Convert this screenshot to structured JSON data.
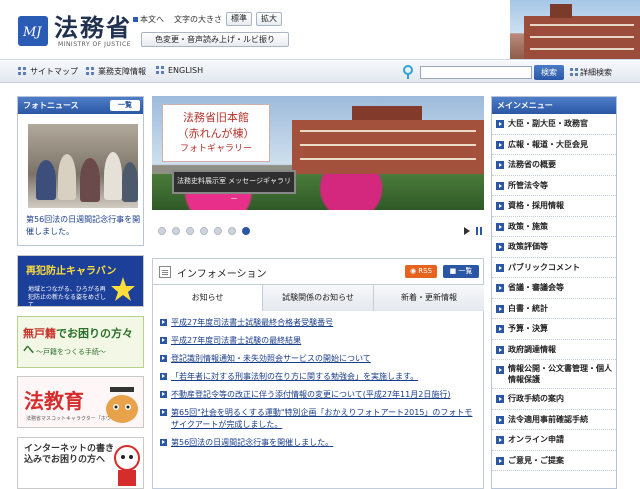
{
  "header": {
    "site_title": "法務省",
    "site_subtitle": "MINISTRY OF JUSTICE",
    "text_link": "本文へ",
    "font_size_label": "文字の大きさ",
    "size_normal": "標準",
    "size_large": "拡大",
    "accessibility": "色変更・音声読み上げ・ルビ振り"
  },
  "subnav": {
    "sitemap": "サイトマップ",
    "business": "業務支障情報",
    "english": "ENGLISH",
    "search_placeholder": "",
    "search_button": "検索",
    "advanced_search": "詳細検索"
  },
  "photo_news": {
    "title": "フォトニュース",
    "list_button": "一覧",
    "caption": "第56回法の日週間記念行事を開催しました。"
  },
  "banners": {
    "caravan_title": "再犯防止キャラバン",
    "caravan_text": "地域とつながる、ひろがる再犯防止の新たなる姿をめざして",
    "koseki_title_red": "無戸籍",
    "koseki_title_rest": "でお困りの方々へ",
    "koseki_subtitle": "～戸籍をつくる手続～",
    "hokyoiku_title": "法教育",
    "hokyoiku_subtitle": "法務省マスコットキャラクター「ホウリス君」",
    "internet_title": "インターネットの書き込みでお困りの方へ"
  },
  "slideshow": {
    "title_line1": "法務省旧本館",
    "title_line2": "（赤れんが棟）",
    "title_line3": "フォトギャラリー",
    "sign_text": "法務史料展示室 メッセージギャラリー",
    "dot_count": 7,
    "active_dot": 7
  },
  "info": {
    "title": "インフォメーション",
    "rss": "RSS",
    "list_button": "一覧",
    "tabs": [
      "お知らせ",
      "試験関係のお知らせ",
      "新着・更新情報"
    ],
    "items": [
      "平成27年度司法書士試験最終合格者受験番号",
      "平成27年度司法書士試験の最終結果",
      "登記識別情報通知・未失効照会サービスの開始について",
      "「若年者に対する刑事法制の在り方に関する勉強会」を実施します。",
      "不動産登記令等の改正に伴う添付情報の変更について(平成27年11月2日施行)",
      "第65回\"社会を明るくする運動\"特別企画「おかえりフォトアート2015」のフォトモザイクアートが完成しました。",
      "第56回法の日週間記念行事を開催しました。"
    ]
  },
  "main_menu": {
    "title": "メインメニュー",
    "items": [
      "大臣・副大臣・政務官",
      "広報・報道・大臣会見",
      "法務省の概要",
      "所管法令等",
      "資格・採用情報",
      "政策・施策",
      "政策評価等",
      "パブリックコメント",
      "省議・審議会等",
      "白書・統計",
      "予算・決算",
      "政府調達情報",
      "情報公開・公文書管理・個人情報保護",
      "行政手続の案内",
      "法令適用事前確認手続",
      "オンライン申請",
      "ご意見・ご提案"
    ]
  },
  "colors": {
    "brand_blue": "#2a56a3",
    "link_blue": "#1a3e8c",
    "rss_orange": "#e8621f"
  }
}
